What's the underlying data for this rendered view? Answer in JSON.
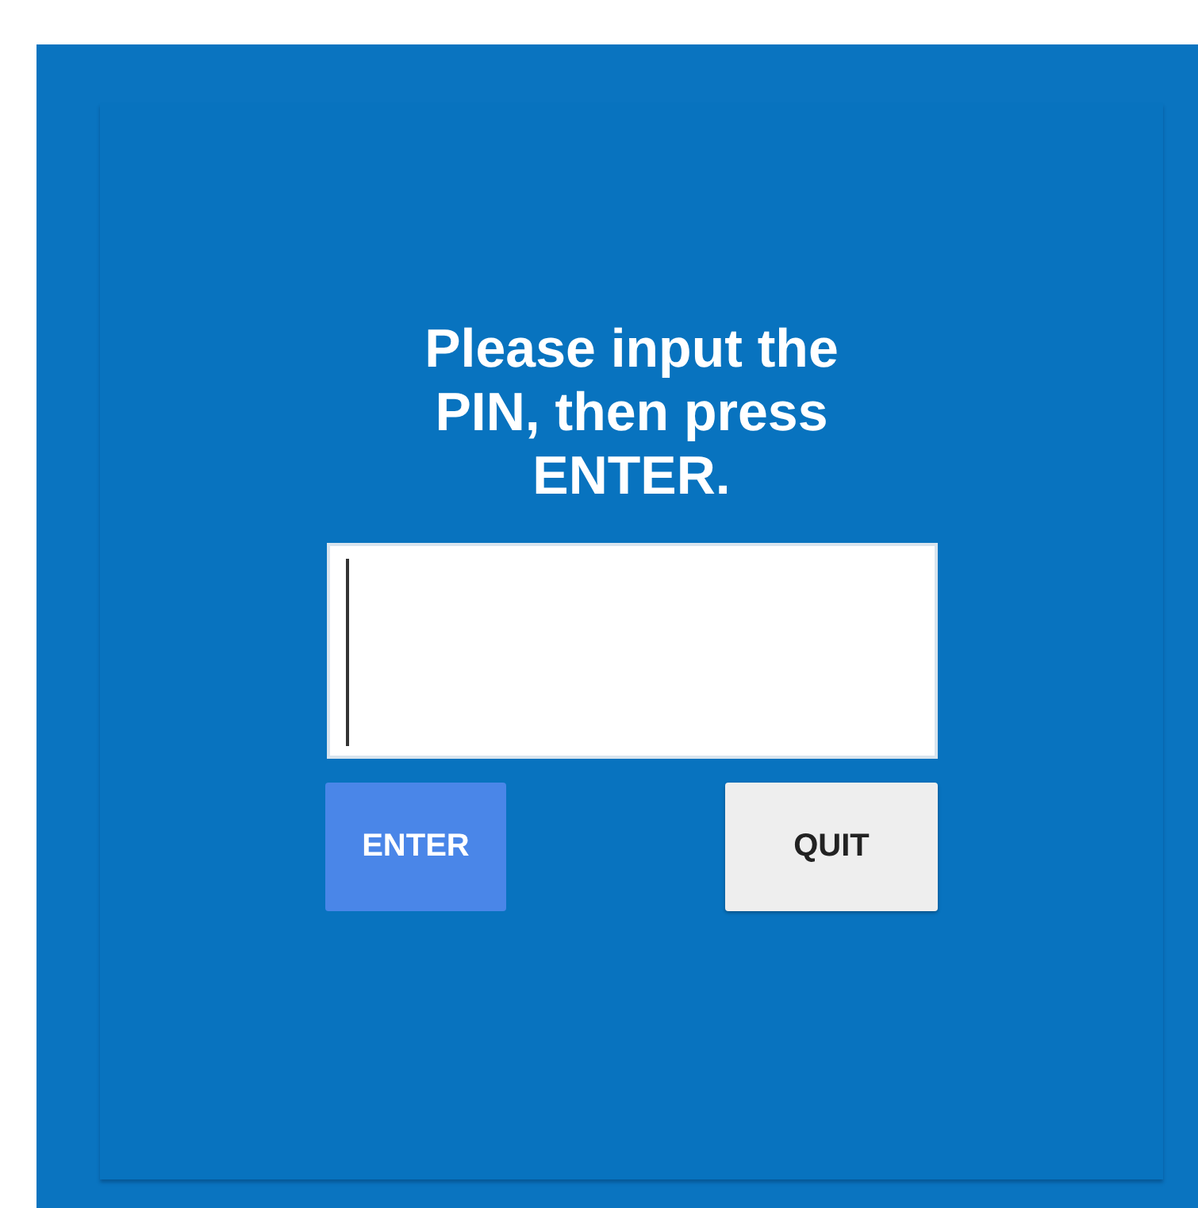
{
  "prompt": "Please input the PIN, then press ENTER.",
  "buttons": [
    {
      "label": "ENTER",
      "kind": "primary"
    },
    {
      "label": "QUIT",
      "kind": "secondary"
    }
  ]
}
